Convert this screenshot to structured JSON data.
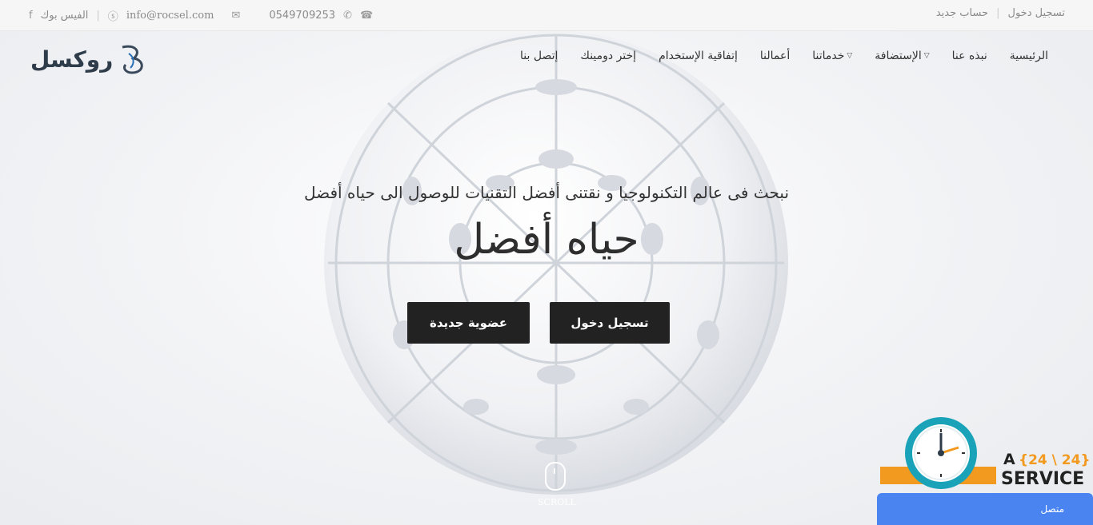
{
  "topbar": {
    "facebook_label": "الفيس بوك",
    "email": "info@rocsel.com",
    "phone": "0549709253",
    "login": "تسجيل دخول",
    "register": "حساب جديد"
  },
  "logo": {
    "text": "روكسل"
  },
  "nav": {
    "items": [
      {
        "label": "الرئيسية"
      },
      {
        "label": "نبذه عنا"
      },
      {
        "label": "الإستضافة"
      },
      {
        "label": "خدماتنا"
      },
      {
        "label": "أعمالنا"
      },
      {
        "label": "إتفاقية الإستخدام"
      },
      {
        "label": "إختر دومينك"
      },
      {
        "label": "إتصل بنا"
      }
    ]
  },
  "hero": {
    "tagline": "نبحث فى عالم التكنولوجيا و نقتنى أفضل التقنيات للوصول الى حياه أفضل",
    "title": "حياه أفضل",
    "login_button": "تسجيل دخول",
    "signup_button": "عضوية جديدة",
    "scroll_label": "SCROLL"
  },
  "service_badge": {
    "prefix": "A",
    "hours": "{24 \\ 24}",
    "word": "SERVICE"
  },
  "chat": {
    "status": "متصل"
  },
  "colors": {
    "button": "#222222",
    "chat": "#4a84f0",
    "badge_orange": "#f29a1f",
    "clock_teal": "#1aa3b8"
  }
}
